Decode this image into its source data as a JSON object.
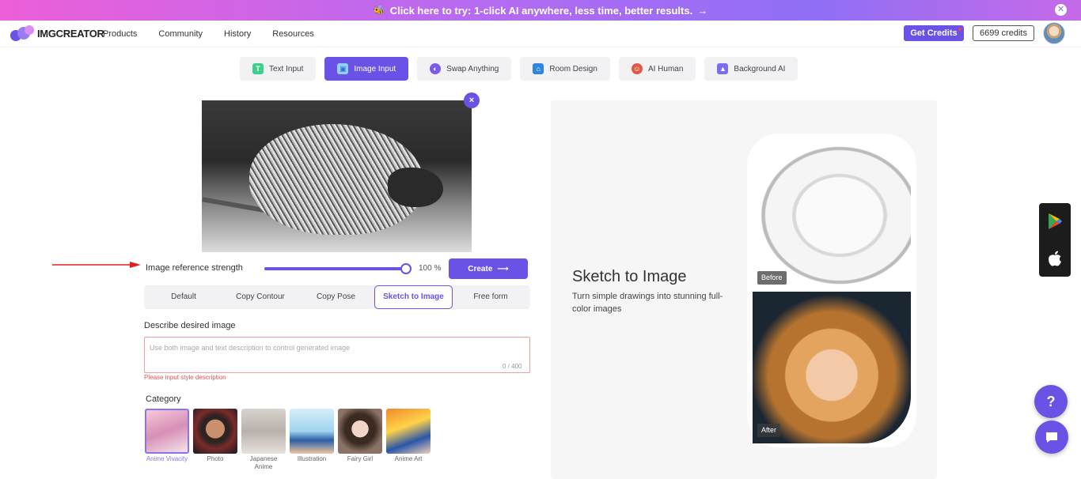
{
  "banner": {
    "text": "Click here to try: 1-click AI anywhere, less time, better results.",
    "arrow": "→",
    "close": "✕"
  },
  "nav": {
    "logo": "IMGCREATOR",
    "links": [
      "Products",
      "Community",
      "History",
      "Resources"
    ],
    "get_credits": "Get Credits",
    "credits": "6699 credits"
  },
  "tabs": [
    {
      "label": "Text Input",
      "icon": "text-icon",
      "color": "#3ecf8e",
      "glyph": "T"
    },
    {
      "label": "Image Input",
      "icon": "image-icon",
      "color": "#ffffff",
      "glyph": "▣"
    },
    {
      "label": "Swap Anything",
      "icon": "swap-icon",
      "color": "#7b5be9",
      "glyph": "◐"
    },
    {
      "label": "Room Design",
      "icon": "house-icon",
      "color": "#2e86de",
      "glyph": "⌂"
    },
    {
      "label": "AI Human",
      "icon": "human-icon",
      "color": "#e05a47",
      "glyph": "☺"
    },
    {
      "label": "Background AI",
      "icon": "mountain-icon",
      "color": "#7c6cf0",
      "glyph": "▲"
    }
  ],
  "active_tab": "Image Input",
  "upload": {
    "remove": "×"
  },
  "strength": {
    "label": "Image reference strength",
    "value": "100 %",
    "level": 1.0
  },
  "create_button": "Create",
  "create_arrow": "⟶",
  "modes": [
    "Default",
    "Copy Contour",
    "Copy Pose",
    "Sketch to Image",
    "Free form"
  ],
  "active_mode": "Sketch to Image",
  "describe": {
    "label": "Describe desired image",
    "placeholder": "Use both image and text description to control generated image",
    "count": "0 / 400",
    "error": "Please input style description"
  },
  "category": {
    "label": "Category",
    "items": [
      {
        "name": "Anime Vivacity",
        "active": true
      },
      {
        "name": "Photo"
      },
      {
        "name": "Japanese Anime"
      },
      {
        "name": "Illustration"
      },
      {
        "name": "Fairy Girl"
      },
      {
        "name": "Anime Art"
      }
    ]
  },
  "preview": {
    "title": "Sketch to Image",
    "subtitle": "Turn simple drawings into stunning full-color images",
    "before": "Before",
    "after": "After"
  },
  "widgets": {
    "help": "?",
    "chat": "💬"
  }
}
